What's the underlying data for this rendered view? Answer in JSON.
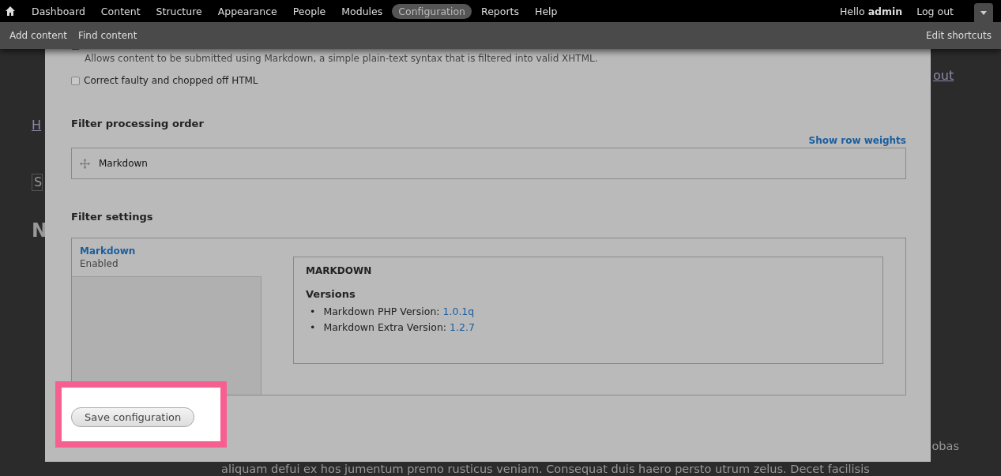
{
  "toolbar": {
    "menu": [
      {
        "label": "Dashboard",
        "selected": false
      },
      {
        "label": "Content",
        "selected": false
      },
      {
        "label": "Structure",
        "selected": false
      },
      {
        "label": "Appearance",
        "selected": false
      },
      {
        "label": "People",
        "selected": false
      },
      {
        "label": "Modules",
        "selected": false
      },
      {
        "label": "Configuration",
        "selected": true
      },
      {
        "label": "Reports",
        "selected": false
      },
      {
        "label": "Help",
        "selected": false
      }
    ],
    "greeting": "Hello **admin**",
    "logout": "Log out",
    "shortcuts": [
      "Add content",
      "Find content"
    ],
    "edit_shortcuts": "Edit shortcuts"
  },
  "background_page": {
    "link_fragment": "out",
    "breadcrumb_fragment": "H",
    "button_fragment": "S",
    "heading_fragment": "N",
    "body_lines": [
      "obas",
      "aliquam defui ex hos jumentum premo rusticus veniam. Consequat duis haero persto utrum zelus. Decet facilisis"
    ]
  },
  "dialog": {
    "filters": [
      {
        "checked": true,
        "description": "Allows content to be submitted using Markdown, a simple plain-text syntax that is filtered into valid XHTML."
      },
      {
        "checked": false,
        "label": "Correct faulty and chopped off HTML"
      }
    ],
    "processing_order": {
      "title": "Filter processing order",
      "show_row_weights": "Show row weights",
      "rows": [
        {
          "label": "Markdown"
        }
      ]
    },
    "filter_settings": {
      "title": "Filter settings",
      "tabs": [
        {
          "title": "Markdown",
          "summary": "Enabled",
          "selected": true
        }
      ],
      "pane": {
        "title": "MARKDOWN",
        "subtitle": "Versions",
        "items": [
          {
            "marker": "•",
            "label": "Markdown PHP Version:",
            "value": "1.0.1q"
          },
          {
            "marker": "•",
            "label": "Markdown Extra Version:",
            "value": "1.2.7"
          }
        ]
      }
    },
    "save_button": {
      "label": "Save configuration",
      "highlighted": true
    }
  }
}
